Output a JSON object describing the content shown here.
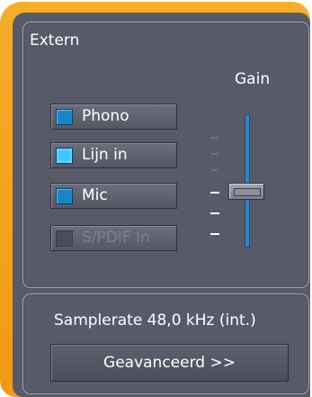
{
  "extern_group": {
    "title": "Extern",
    "gain_label": "Gain",
    "sources": [
      {
        "label": "Phono",
        "active": false,
        "enabled": true
      },
      {
        "label": "Lijn in",
        "active": true,
        "enabled": true
      },
      {
        "label": "Mic",
        "active": false,
        "enabled": true
      },
      {
        "label": "S/PDIF In",
        "active": false,
        "enabled": false
      }
    ],
    "gain_level": 0.45
  },
  "samplerate_group": {
    "samplerate_text": "Samplerate  48,0 kHz (int.)",
    "advanced_button": "Geavanceerd >>"
  },
  "colors": {
    "frame": "#f4a21c",
    "panel": "#585a69",
    "led_active": "#3fc8ff",
    "led_idle": "#1a86c8",
    "slider_track": "#2f84c5"
  },
  "icons": [
    "led-indicator-icon",
    "slider-thumb-icon"
  ]
}
